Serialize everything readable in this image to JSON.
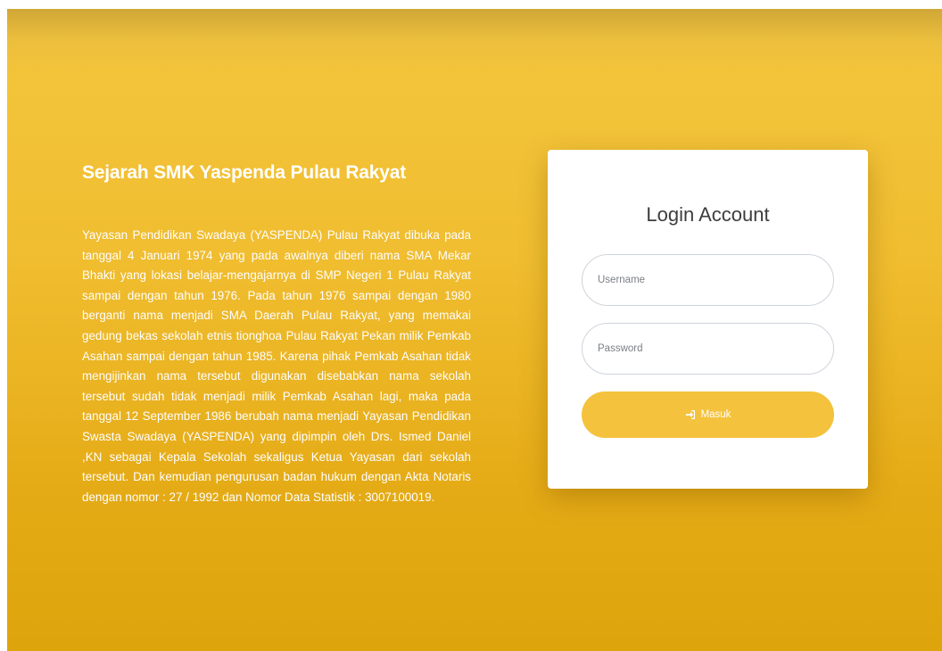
{
  "history": {
    "title": "Sejarah SMK Yaspenda Pulau Rakyat",
    "body": "Yayasan Pendidikan Swadaya (YASPENDA) Pulau Rakyat dibuka pada tanggal 4 Januari 1974 yang pada awalnya diberi nama SMA Mekar Bhakti yang lokasi belajar-mengajarnya di SMP Negeri 1 Pulau Rakyat sampai dengan tahun 1976. Pada tahun 1976 sampai dengan 1980 berganti nama menjadi SMA Daerah Pulau Rakyat, yang memakai gedung bekas sekolah etnis tionghoa Pulau Rakyat Pekan milik Pemkab Asahan sampai dengan tahun 1985. Karena pihak Pemkab Asahan tidak mengijinkan nama tersebut digunakan disebabkan nama sekolah tersebut sudah tidak menjadi milik Pemkab Asahan lagi, maka pada tanggal 12 September 1986 berubah nama menjadi Yayasan Pendidikan Swasta Swadaya (YASPENDA) yang dipimpin oleh Drs. Ismed Daniel ,KN sebagai Kepala Sekolah sekaligus Ketua Yayasan dari sekolah tersebut. Dan kemudian pengurusan badan hukum dengan Akta Notaris dengan nomor : 27 / 1992 dan Nomor Data Statistik : 3007100019."
  },
  "login": {
    "title": "Login Account",
    "username_placeholder": "Username",
    "username_value": "",
    "password_placeholder": "Password",
    "password_value": "",
    "submit_label": "Masuk",
    "submit_icon": "sign-in-icon"
  },
  "colors": {
    "accent": "#f4c23c",
    "background_top": "#f4c63e",
    "background_bottom": "#dea40c"
  }
}
